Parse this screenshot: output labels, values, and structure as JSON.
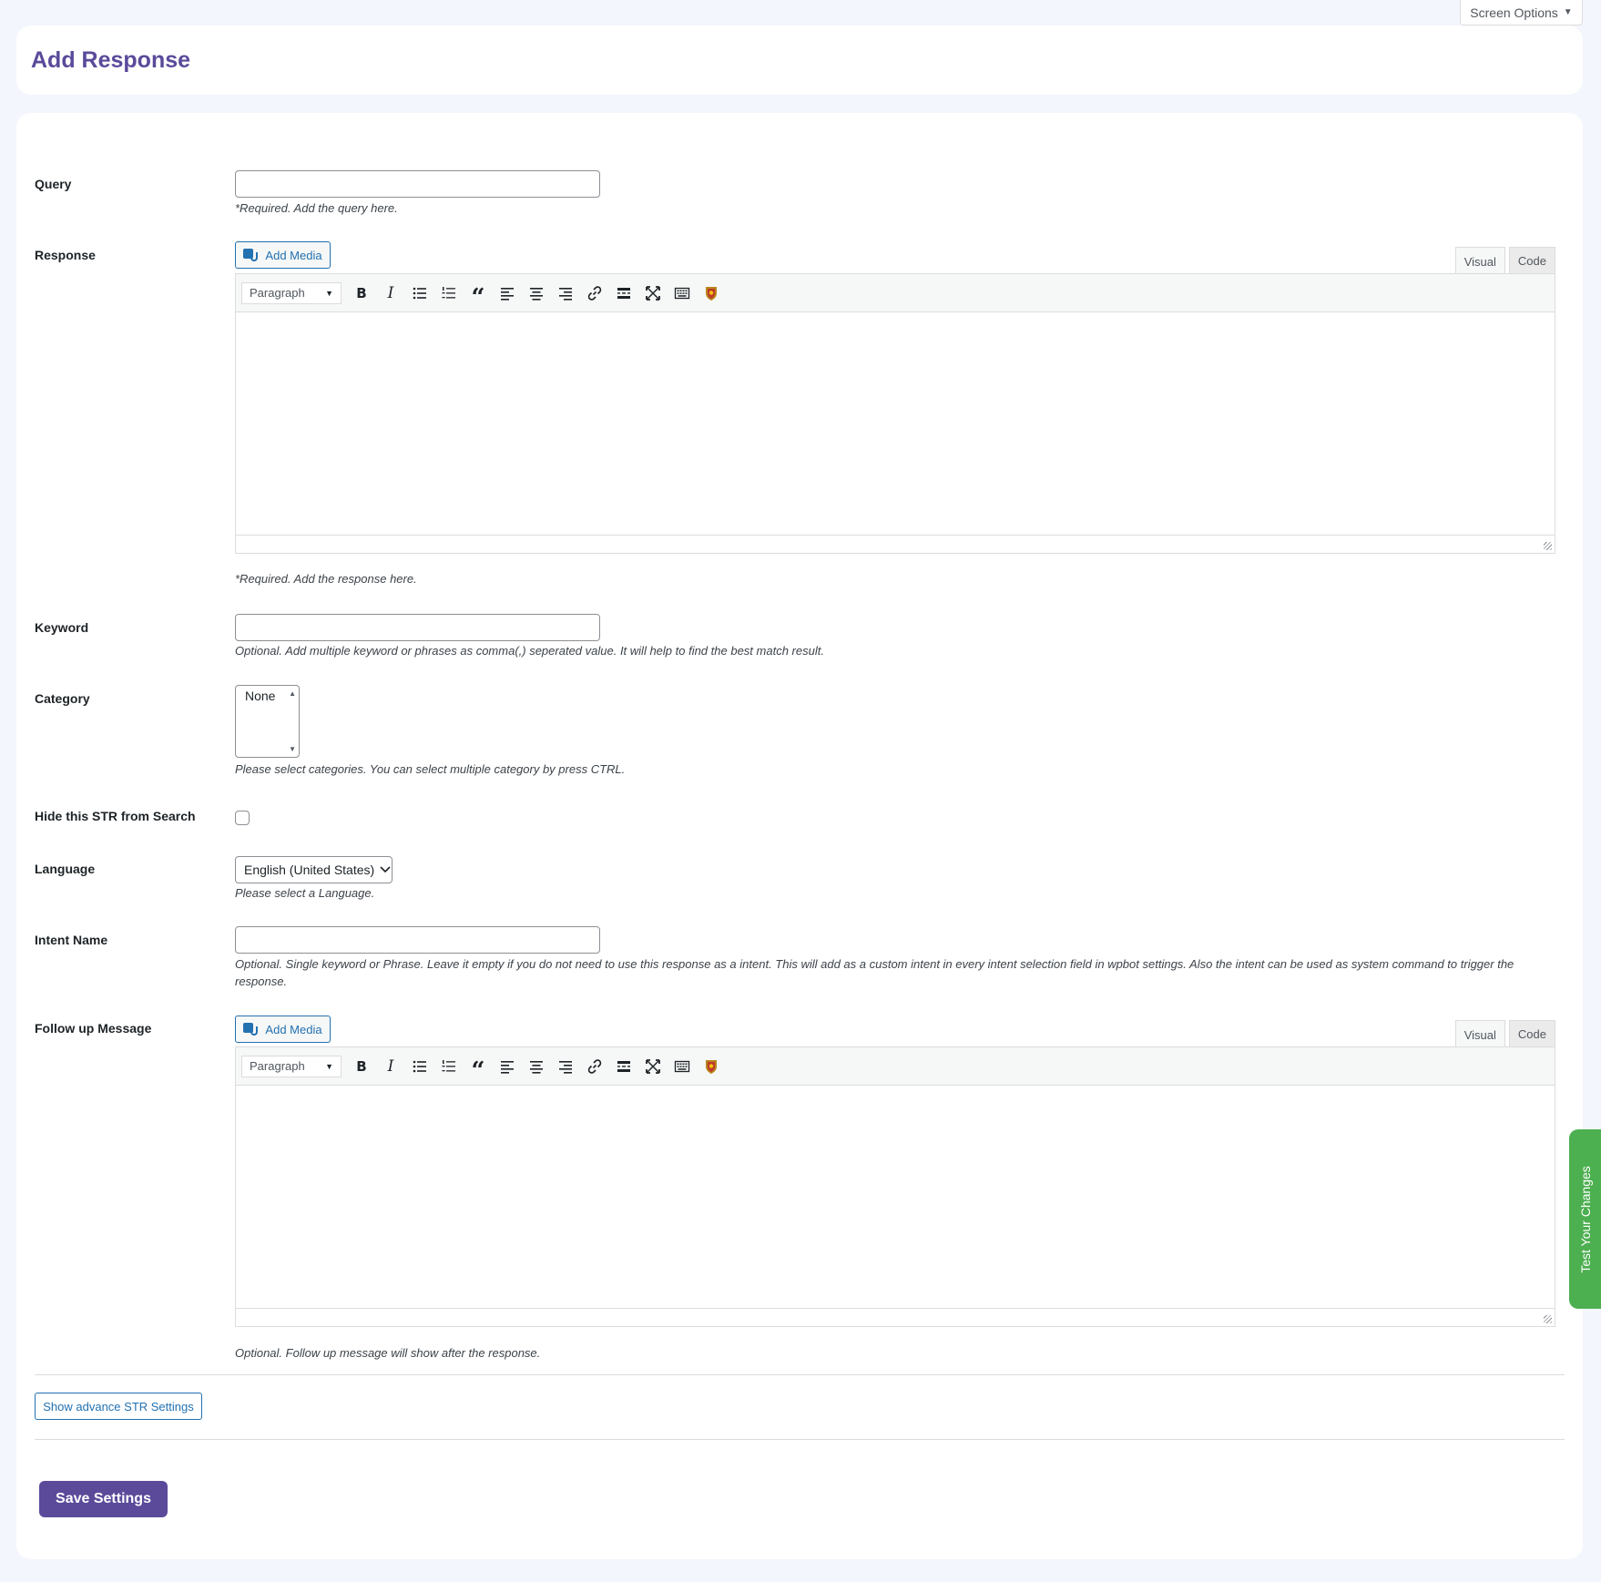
{
  "screen_options": {
    "label": "Screen Options",
    "caret": "▼"
  },
  "page": {
    "title": "Add Response"
  },
  "query": {
    "label": "Query",
    "value": "",
    "description": "*Required. Add the query here."
  },
  "response": {
    "label": "Response",
    "add_media": "Add Media",
    "tab_visual": "Visual",
    "tab_code": "Code",
    "format": "Paragraph",
    "description": "*Required. Add the response here."
  },
  "keyword": {
    "label": "Keyword",
    "value": "",
    "description": "Optional. Add multiple keyword or phrases as comma(,) seperated value. It will help to find the best match result."
  },
  "category": {
    "label": "Category",
    "option": "None",
    "description": "Please select categories. You can select multiple category by press CTRL."
  },
  "hide_search": {
    "label": "Hide this STR from Search",
    "checked": false
  },
  "language": {
    "label": "Language",
    "selected": "English (United States)",
    "description": "Please select a Language."
  },
  "intent": {
    "label": "Intent Name",
    "value": "",
    "description": "Optional. Single keyword or Phrase. Leave it empty if you do not need to use this response as a intent. This will add as a custom intent in every intent selection field in wpbot settings. Also the intent can be used as system command to trigger the response."
  },
  "followup": {
    "label": "Follow up Message",
    "add_media": "Add Media",
    "tab_visual": "Visual",
    "tab_code": "Code",
    "format": "Paragraph",
    "description": "Optional. Follow up message will show after the response."
  },
  "advance_button": "Show advance STR Settings",
  "save_button": "Save Settings",
  "test_tab": "Test Your Changes",
  "colors": {
    "accent": "#5b4a9a",
    "link": "#2271b1",
    "test_tab": "#4caf50"
  }
}
